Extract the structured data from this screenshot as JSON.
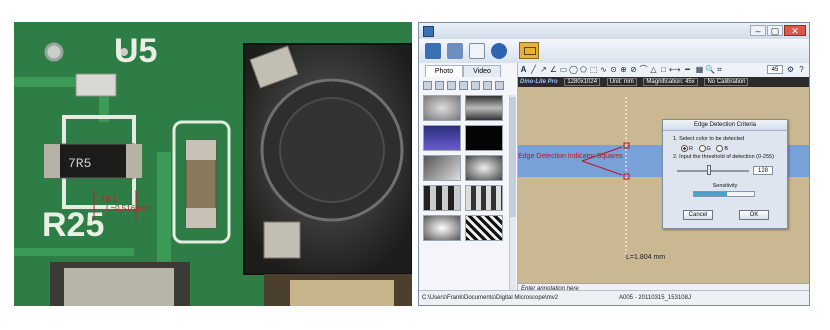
{
  "photo": {
    "silkscreen_u5": "U5",
    "silkscreen_r25": "R25",
    "component_marking": "7R5",
    "dimension_id": "DL1",
    "dimension_value": "L=0.516 mm"
  },
  "window": {
    "controls": {
      "minimize": "–",
      "maximize": "▢",
      "close": "✕"
    }
  },
  "left_panel": {
    "tabs": [
      {
        "label": "Photo"
      },
      {
        "label": "Video"
      }
    ]
  },
  "viewer": {
    "brand": "Dino-Lite Pro",
    "resolution": "1280x1024",
    "unit": "Unit: mm",
    "magnification": "Magnification: 45x",
    "calibration": "No Calibration",
    "edge_indicator_label": "Edge Detection Indicator Squares",
    "measurement": "L=1.804 mm",
    "annotation_placeholder": "Enter annotation here",
    "zoom_value": "45"
  },
  "dialog": {
    "title": "Edge Detection Criteria",
    "step1": "1. Select color to be detected",
    "radio_r": "R",
    "radio_g": "G",
    "radio_b": "B",
    "step2": "2. Input the threshold of detection (0-255)",
    "threshold_value": "128",
    "sensitivity_label": "Sensitivity",
    "sensitivity_level": 0.55,
    "cancel_label": "Cancel",
    "ok_label": "OK"
  },
  "statusbar": {
    "path": "C:\\Users\\Frank\\Documents\\Digital Microscope\\mv2",
    "file": "A005 - 20110315_153108J"
  },
  "colors": {
    "pcb_green": "#2f7d46",
    "background_tan": "#c9b891",
    "tape_blue": "#6f9fe0",
    "label_red": "#c0141c",
    "accent_blue": "#3b6fb6"
  }
}
